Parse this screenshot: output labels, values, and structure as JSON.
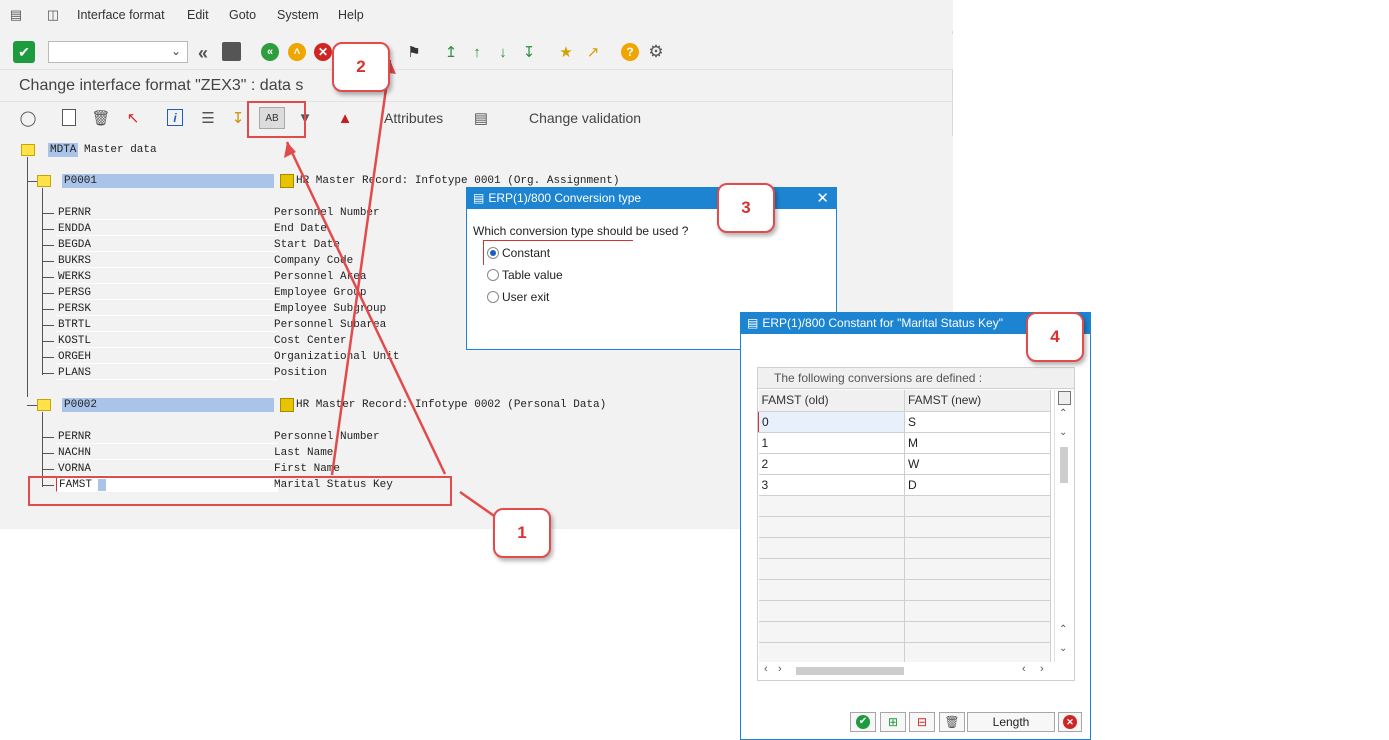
{
  "menu": [
    "Interface format",
    "Edit",
    "Goto",
    "System",
    "Help"
  ],
  "title": "Change interface format \"ZEX3\" : data s",
  "toolbar2": {
    "attributes": "Attributes",
    "change_validation": "Change validation"
  },
  "tree": {
    "root": {
      "key": "MDTA",
      "label": "Master data"
    },
    "p0001": {
      "key": "P0001",
      "desc": "HR Master Record: Infotype 0001 (Org. Assignment)",
      "fields": [
        [
          "PERNR",
          "Personnel Number"
        ],
        [
          "ENDDA",
          "End Date"
        ],
        [
          "BEGDA",
          "Start Date"
        ],
        [
          "BUKRS",
          "Company Code"
        ],
        [
          "WERKS",
          "Personnel Area"
        ],
        [
          "PERSG",
          "Employee Group"
        ],
        [
          "PERSK",
          "Employee Subgroup"
        ],
        [
          "BTRTL",
          "Personnel Subarea"
        ],
        [
          "KOSTL",
          "Cost Center"
        ],
        [
          "ORGEH",
          "Organizational Unit"
        ],
        [
          "PLANS",
          "Position"
        ]
      ]
    },
    "p0002": {
      "key": "P0002",
      "desc": "HR Master Record: Infotype 0002 (Personal Data)",
      "fields": [
        [
          "PERNR",
          "Personnel Number"
        ],
        [
          "NACHN",
          "Last Name"
        ],
        [
          "VORNA",
          "First Name"
        ],
        [
          "FAMST",
          "Marital Status Key"
        ]
      ]
    }
  },
  "conv_popup": {
    "title": "ERP(1)/800 Conversion type",
    "question": "Which conversion type should be used ?",
    "options": [
      "Constant",
      "Table value",
      "User exit"
    ],
    "selected": 0
  },
  "const_popup": {
    "title": "ERP(1)/800 Constant for \"Marital Status Key\"",
    "header": "The following conversions are defined :",
    "col_old": "FAMST (old)",
    "col_new": "FAMST (new)",
    "rows": [
      [
        "0",
        "S"
      ],
      [
        "1",
        "M"
      ],
      [
        "2",
        "W"
      ],
      [
        "3",
        "D"
      ]
    ],
    "length_button": "Length"
  },
  "callouts": [
    "1",
    "2",
    "3",
    "4"
  ],
  "colors": {
    "accent": "#1c84d1",
    "callout": "#e24b4b",
    "highlight": "#a9c4e8"
  }
}
